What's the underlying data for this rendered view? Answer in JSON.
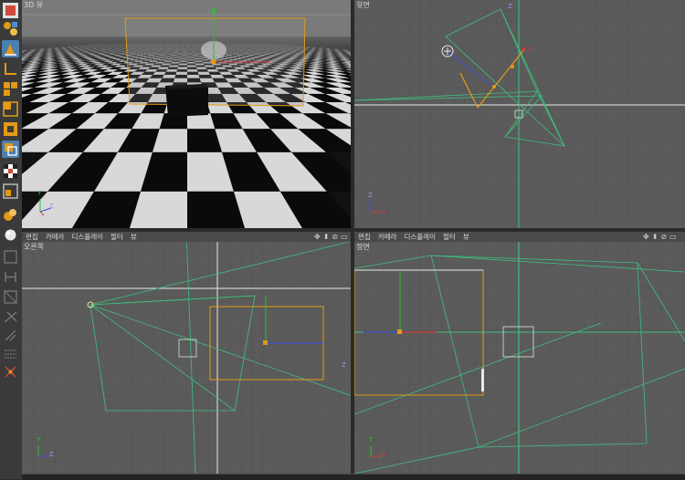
{
  "viewports": {
    "top_left": {
      "title": "3D 뷰"
    },
    "top_right": {
      "title": "윗면"
    },
    "bottom_left": {
      "title": "오른쪽"
    },
    "bottom_right": {
      "title": "정면"
    }
  },
  "menu": {
    "items": [
      "편집",
      "카메라",
      "디스플레이",
      "필터",
      "뷰"
    ]
  },
  "nav_icons": [
    "✥",
    "⬍",
    "⊘",
    "▭"
  ],
  "axes": {
    "x": "X",
    "y": "Y",
    "z": "Z"
  },
  "colors": {
    "viewport_bg": "#5b5b5b",
    "grid_line": "#555555",
    "frustum": "#3fbf7f",
    "selection": "#e39a16",
    "axis_x": "#d43b3b",
    "axis_y": "#2fbf2f",
    "axis_z": "#3f4fd0"
  },
  "toolbar": {
    "icons": [
      "object-icon",
      "primitives-icon",
      "move-icon",
      "axis-icon",
      "grid-icon",
      "cube-icon",
      "deform-icon",
      "light-icon",
      "checker-icon",
      "render-icon",
      "material-icon",
      "sphere-icon",
      "layer-icon",
      "bone-icon",
      "cage-icon",
      "spline-icon",
      "paint-icon",
      "measure-icon",
      "snap-icon",
      "sculpt-icon",
      "rig-icon"
    ]
  }
}
